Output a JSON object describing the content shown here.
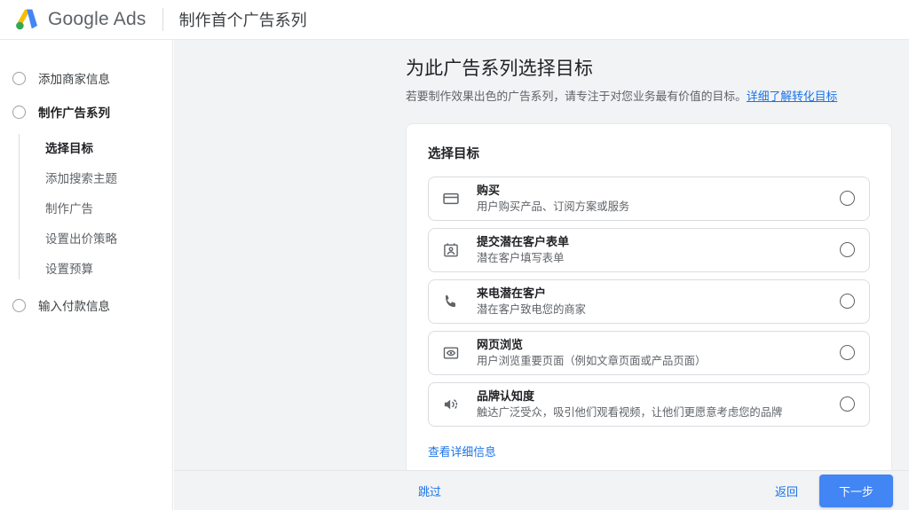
{
  "topbar": {
    "logo_icon": "google-ads-logo",
    "brand": "Google Ads",
    "flow_title": "制作首个广告系列",
    "logo_colors": {
      "blue": "#4285F4",
      "yellow": "#FBBC04",
      "green": "#34A853"
    }
  },
  "sidebar": {
    "steps": [
      {
        "label": "添加商家信息",
        "current": false,
        "substeps": []
      },
      {
        "label": "制作广告系列",
        "current": true,
        "substeps": [
          {
            "label": "选择目标",
            "active": true
          },
          {
            "label": "添加搜索主题",
            "active": false
          },
          {
            "label": "制作广告",
            "active": false
          },
          {
            "label": "设置出价策略",
            "active": false
          },
          {
            "label": "设置预算",
            "active": false
          }
        ]
      },
      {
        "label": "输入付款信息",
        "current": false,
        "substeps": []
      }
    ]
  },
  "main": {
    "page_title": "为此广告系列选择目标",
    "page_subtitle": "若要制作效果出色的广告系列，请专注于对您业务最有价值的目标。",
    "page_subtitle_link": "详细了解转化目标",
    "card": {
      "title": "选择目标",
      "goals": [
        {
          "icon": "credit-card-icon",
          "name": "购买",
          "desc": "用户购买产品、订阅方案或服务",
          "selected": false
        },
        {
          "icon": "lead-form-icon",
          "name": "提交潜在客户表单",
          "desc": "潜在客户填写表单",
          "selected": false
        },
        {
          "icon": "phone-icon",
          "name": "来电潜在客户",
          "desc": "潜在客户致电您的商家",
          "selected": false
        },
        {
          "icon": "page-view-icon",
          "name": "网页浏览",
          "desc": "用户浏览重要页面（例如文章页面或产品页面）",
          "selected": false
        },
        {
          "icon": "speaker-icon",
          "name": "品牌认知度",
          "desc": "触达广泛受众，吸引他们观看视频，让他们更愿意考虑您的品牌",
          "selected": false
        }
      ],
      "details_link": "查看详细信息"
    }
  },
  "footer": {
    "skip_label": "跳过",
    "back_label": "返回",
    "next_label": "下一步",
    "primary_color": "#4285f4"
  }
}
